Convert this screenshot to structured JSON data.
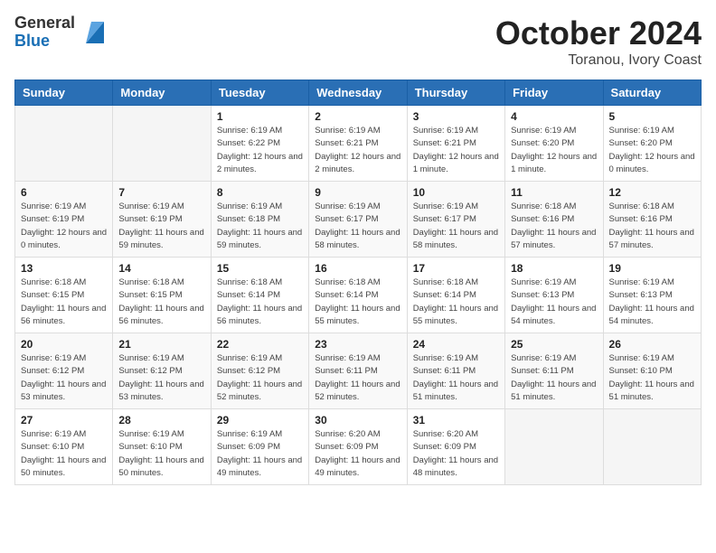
{
  "logo": {
    "line1": "General",
    "line2": "Blue"
  },
  "title": "October 2024",
  "subtitle": "Toranou, Ivory Coast",
  "days_of_week": [
    "Sunday",
    "Monday",
    "Tuesday",
    "Wednesday",
    "Thursday",
    "Friday",
    "Saturday"
  ],
  "weeks": [
    [
      {
        "day": "",
        "info": ""
      },
      {
        "day": "",
        "info": ""
      },
      {
        "day": "1",
        "info": "Sunrise: 6:19 AM\nSunset: 6:22 PM\nDaylight: 12 hours and 2 minutes."
      },
      {
        "day": "2",
        "info": "Sunrise: 6:19 AM\nSunset: 6:21 PM\nDaylight: 12 hours and 2 minutes."
      },
      {
        "day": "3",
        "info": "Sunrise: 6:19 AM\nSunset: 6:21 PM\nDaylight: 12 hours and 1 minute."
      },
      {
        "day": "4",
        "info": "Sunrise: 6:19 AM\nSunset: 6:20 PM\nDaylight: 12 hours and 1 minute."
      },
      {
        "day": "5",
        "info": "Sunrise: 6:19 AM\nSunset: 6:20 PM\nDaylight: 12 hours and 0 minutes."
      }
    ],
    [
      {
        "day": "6",
        "info": "Sunrise: 6:19 AM\nSunset: 6:19 PM\nDaylight: 12 hours and 0 minutes."
      },
      {
        "day": "7",
        "info": "Sunrise: 6:19 AM\nSunset: 6:19 PM\nDaylight: 11 hours and 59 minutes."
      },
      {
        "day": "8",
        "info": "Sunrise: 6:19 AM\nSunset: 6:18 PM\nDaylight: 11 hours and 59 minutes."
      },
      {
        "day": "9",
        "info": "Sunrise: 6:19 AM\nSunset: 6:17 PM\nDaylight: 11 hours and 58 minutes."
      },
      {
        "day": "10",
        "info": "Sunrise: 6:19 AM\nSunset: 6:17 PM\nDaylight: 11 hours and 58 minutes."
      },
      {
        "day": "11",
        "info": "Sunrise: 6:18 AM\nSunset: 6:16 PM\nDaylight: 11 hours and 57 minutes."
      },
      {
        "day": "12",
        "info": "Sunrise: 6:18 AM\nSunset: 6:16 PM\nDaylight: 11 hours and 57 minutes."
      }
    ],
    [
      {
        "day": "13",
        "info": "Sunrise: 6:18 AM\nSunset: 6:15 PM\nDaylight: 11 hours and 56 minutes."
      },
      {
        "day": "14",
        "info": "Sunrise: 6:18 AM\nSunset: 6:15 PM\nDaylight: 11 hours and 56 minutes."
      },
      {
        "day": "15",
        "info": "Sunrise: 6:18 AM\nSunset: 6:14 PM\nDaylight: 11 hours and 56 minutes."
      },
      {
        "day": "16",
        "info": "Sunrise: 6:18 AM\nSunset: 6:14 PM\nDaylight: 11 hours and 55 minutes."
      },
      {
        "day": "17",
        "info": "Sunrise: 6:18 AM\nSunset: 6:14 PM\nDaylight: 11 hours and 55 minutes."
      },
      {
        "day": "18",
        "info": "Sunrise: 6:19 AM\nSunset: 6:13 PM\nDaylight: 11 hours and 54 minutes."
      },
      {
        "day": "19",
        "info": "Sunrise: 6:19 AM\nSunset: 6:13 PM\nDaylight: 11 hours and 54 minutes."
      }
    ],
    [
      {
        "day": "20",
        "info": "Sunrise: 6:19 AM\nSunset: 6:12 PM\nDaylight: 11 hours and 53 minutes."
      },
      {
        "day": "21",
        "info": "Sunrise: 6:19 AM\nSunset: 6:12 PM\nDaylight: 11 hours and 53 minutes."
      },
      {
        "day": "22",
        "info": "Sunrise: 6:19 AM\nSunset: 6:12 PM\nDaylight: 11 hours and 52 minutes."
      },
      {
        "day": "23",
        "info": "Sunrise: 6:19 AM\nSunset: 6:11 PM\nDaylight: 11 hours and 52 minutes."
      },
      {
        "day": "24",
        "info": "Sunrise: 6:19 AM\nSunset: 6:11 PM\nDaylight: 11 hours and 51 minutes."
      },
      {
        "day": "25",
        "info": "Sunrise: 6:19 AM\nSunset: 6:11 PM\nDaylight: 11 hours and 51 minutes."
      },
      {
        "day": "26",
        "info": "Sunrise: 6:19 AM\nSunset: 6:10 PM\nDaylight: 11 hours and 51 minutes."
      }
    ],
    [
      {
        "day": "27",
        "info": "Sunrise: 6:19 AM\nSunset: 6:10 PM\nDaylight: 11 hours and 50 minutes."
      },
      {
        "day": "28",
        "info": "Sunrise: 6:19 AM\nSunset: 6:10 PM\nDaylight: 11 hours and 50 minutes."
      },
      {
        "day": "29",
        "info": "Sunrise: 6:19 AM\nSunset: 6:09 PM\nDaylight: 11 hours and 49 minutes."
      },
      {
        "day": "30",
        "info": "Sunrise: 6:20 AM\nSunset: 6:09 PM\nDaylight: 11 hours and 49 minutes."
      },
      {
        "day": "31",
        "info": "Sunrise: 6:20 AM\nSunset: 6:09 PM\nDaylight: 11 hours and 48 minutes."
      },
      {
        "day": "",
        "info": ""
      },
      {
        "day": "",
        "info": ""
      }
    ]
  ]
}
